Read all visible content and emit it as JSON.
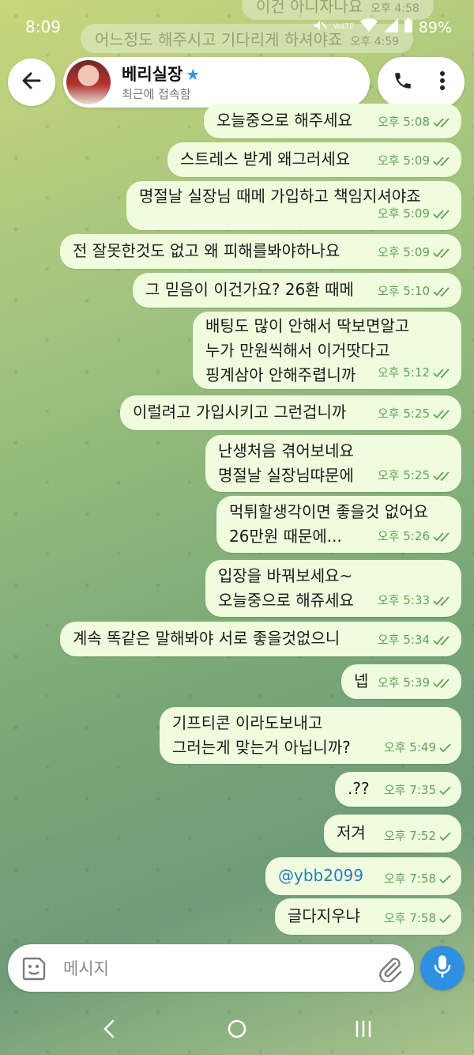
{
  "status_bar": {
    "time": "8:09",
    "network": "VoLTE",
    "battery": "89%"
  },
  "ghost_messages": [
    {
      "text": "이건 아니자나요",
      "time": "오후 4:58"
    },
    {
      "text": "어느정도 해주시고 기다리게 하셔야죠",
      "time": "오후 4:59"
    }
  ],
  "header": {
    "contact_name": "베리실장",
    "status": "최근에 접속함"
  },
  "messages": [
    {
      "text": "오늘중으로 해주세요",
      "time": "오후 5:08",
      "read": true
    },
    {
      "text": "스트레스 받게 왜그러세요",
      "time": "오후 5:09",
      "read": true
    },
    {
      "text": "명절날 실장님 때메 가입하고 책임지셔야죠",
      "time": "오후 5:09",
      "read": true
    },
    {
      "text": "전 잘못한것도 없고 왜 피해를봐야하나요",
      "time": "오후 5:09",
      "read": true
    },
    {
      "text": "그 믿음이 이건가요? 26환 때메",
      "time": "오후 5:10",
      "read": true
    },
    {
      "text": "배팅도 많이 안해서 딱보면알고\n누가 만원씩해서 이거땃다고\n핑계삼아 안해주렵니까",
      "time": "오후 5:12",
      "read": true
    },
    {
      "text": "이럴려고 가입시키고 그런겁니까",
      "time": "오후 5:25",
      "read": true
    },
    {
      "text": "난생처음 겪어보네요\n명절날 실장님땨문에",
      "time": "오후 5:25",
      "read": true
    },
    {
      "text": "먹튀할생각이면 좋을것 없어요\n26만원 때문에...",
      "time": "오후 5:26",
      "read": true
    },
    {
      "text": "입장을 바꿔보세요~\n오늘중으로 해쥬세요",
      "time": "오후 5:33",
      "read": true
    },
    {
      "text": "계속 똑같은 말해봐야 서로 좋을것없으니",
      "time": "오후 5:34",
      "read": true
    },
    {
      "text": "넵",
      "time": "오후 5:39",
      "read": true
    },
    {
      "text": "기프티콘 이라도보내고\n그러는게 맞는거 아닙니까?",
      "time": "오후 5:49",
      "read": false
    },
    {
      "text": ".??",
      "time": "오후 7:35",
      "read": false
    },
    {
      "text": "저겨",
      "time": "오후 7:52",
      "read": false
    },
    {
      "text": "@ybb2099",
      "time": "오후 7:58",
      "read": false,
      "link": true
    },
    {
      "text": "글다지우냐",
      "time": "오후 7:58",
      "read": false
    }
  ],
  "input": {
    "placeholder": "메시지"
  },
  "colors": {
    "bubble": "#effdde",
    "accent": "#2f8fe0",
    "meta": "#5fa155"
  },
  "icons": [
    "back-arrow-icon",
    "verified-star-icon",
    "phone-icon",
    "more-vert-icon",
    "sticker-icon",
    "paperclip-icon",
    "mic-icon"
  ]
}
